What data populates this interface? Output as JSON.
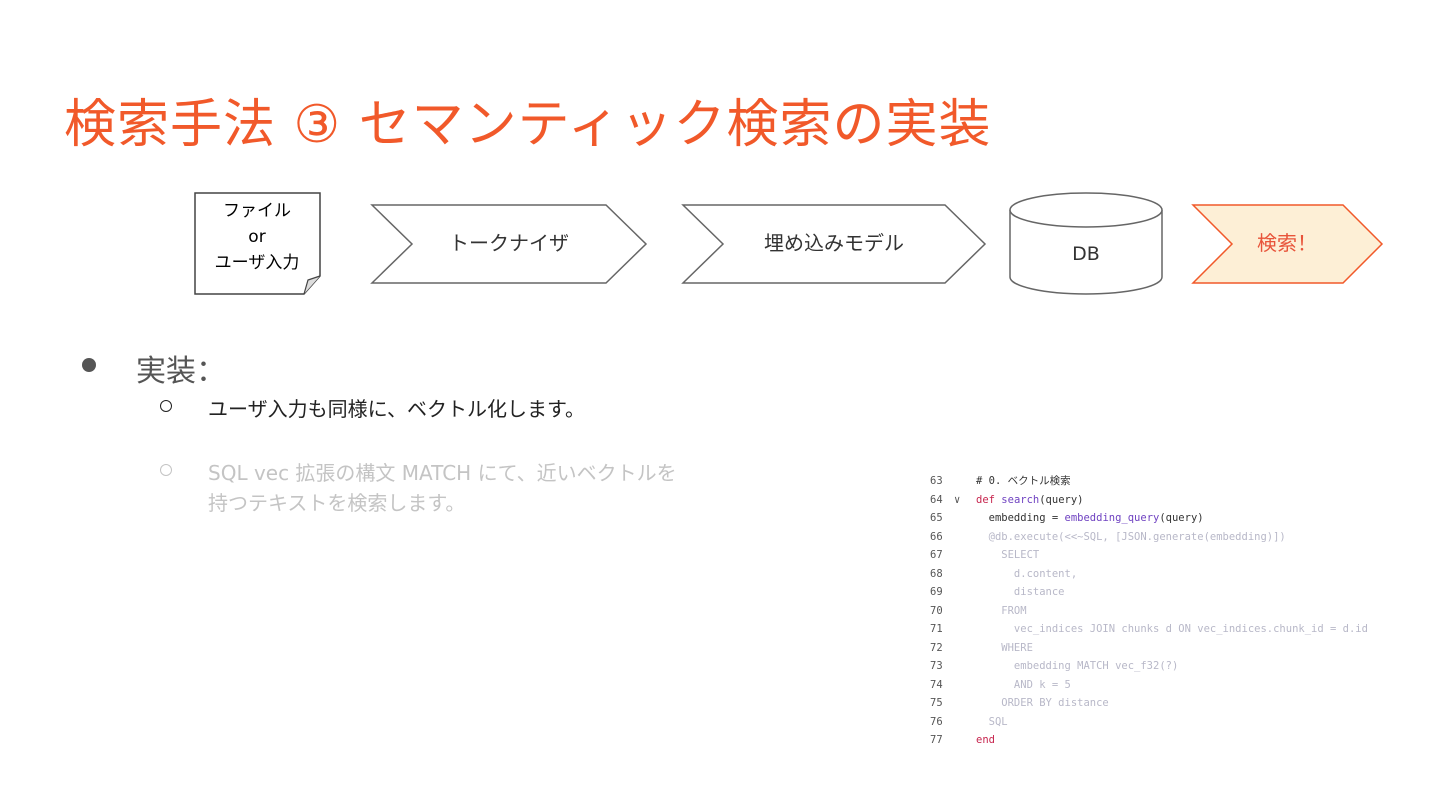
{
  "title": "検索手法 ③ セマンティック検索の実装",
  "flow": {
    "doc_lines": [
      "ファイル",
      "or",
      "ユーザ入力"
    ],
    "steps": [
      "トークナイザ",
      "埋め込みモデル"
    ],
    "db_label": "DB",
    "final_label": "検索！",
    "colors": {
      "stroke": "#666666",
      "highlight_fill": "#fdefd6",
      "highlight_stroke": "#f1592a",
      "highlight_text": "#e8543a"
    }
  },
  "bullets": {
    "main": "実装：",
    "sub1": "ユーザ入力も同様に、ベクトル化します。",
    "sub2_line1": "SQL vec 拡張の構文 MATCH にて、近いベクトルを",
    "sub2_line2": "持つテキストを検索します。"
  },
  "code": {
    "lines": [
      {
        "n": "63",
        "fold": "",
        "tokens": [
          {
            "t": "# 0. ベクトル検索",
            "c": "#333333"
          }
        ]
      },
      {
        "n": "64",
        "fold": "∨",
        "tokens": [
          {
            "t": "def ",
            "c": "#c7254e"
          },
          {
            "t": "search",
            "c": "#6f42c1"
          },
          {
            "t": "(query)",
            "c": "#333333"
          }
        ]
      },
      {
        "n": "65",
        "fold": "",
        "tokens": [
          {
            "t": "  embedding = ",
            "c": "#333333"
          },
          {
            "t": "embedding_query",
            "c": "#6f42c1"
          },
          {
            "t": "(query)",
            "c": "#333333"
          }
        ]
      },
      {
        "n": "66",
        "fold": "",
        "tokens": [
          {
            "t": "  @db.execute(<<~SQL, [JSON.generate(embedding)])",
            "c": "#b8b8c8"
          }
        ]
      },
      {
        "n": "67",
        "fold": "",
        "tokens": [
          {
            "t": "    SELECT",
            "c": "#b8b8c8"
          }
        ]
      },
      {
        "n": "68",
        "fold": "",
        "tokens": [
          {
            "t": "      d.content,",
            "c": "#b8b8c8"
          }
        ]
      },
      {
        "n": "69",
        "fold": "",
        "tokens": [
          {
            "t": "      distance",
            "c": "#b8b8c8"
          }
        ]
      },
      {
        "n": "70",
        "fold": "",
        "tokens": [
          {
            "t": "    FROM",
            "c": "#b8b8c8"
          }
        ]
      },
      {
        "n": "71",
        "fold": "",
        "tokens": [
          {
            "t": "      vec_indices JOIN chunks d ON vec_indices.chunk_id = d.id",
            "c": "#b8b8c8"
          }
        ]
      },
      {
        "n": "72",
        "fold": "",
        "tokens": [
          {
            "t": "    WHERE",
            "c": "#b8b8c8"
          }
        ]
      },
      {
        "n": "73",
        "fold": "",
        "tokens": [
          {
            "t": "      embedding MATCH vec_f32(?)",
            "c": "#b8b8c8"
          }
        ]
      },
      {
        "n": "74",
        "fold": "",
        "tokens": [
          {
            "t": "      AND k = 5",
            "c": "#b8b8c8"
          }
        ]
      },
      {
        "n": "75",
        "fold": "",
        "tokens": [
          {
            "t": "    ORDER BY distance",
            "c": "#b8b8c8"
          }
        ]
      },
      {
        "n": "76",
        "fold": "",
        "tokens": [
          {
            "t": "  SQL",
            "c": "#b8b8c8"
          }
        ]
      },
      {
        "n": "77",
        "fold": "",
        "tokens": [
          {
            "t": "end",
            "c": "#c7254e"
          }
        ]
      }
    ]
  }
}
